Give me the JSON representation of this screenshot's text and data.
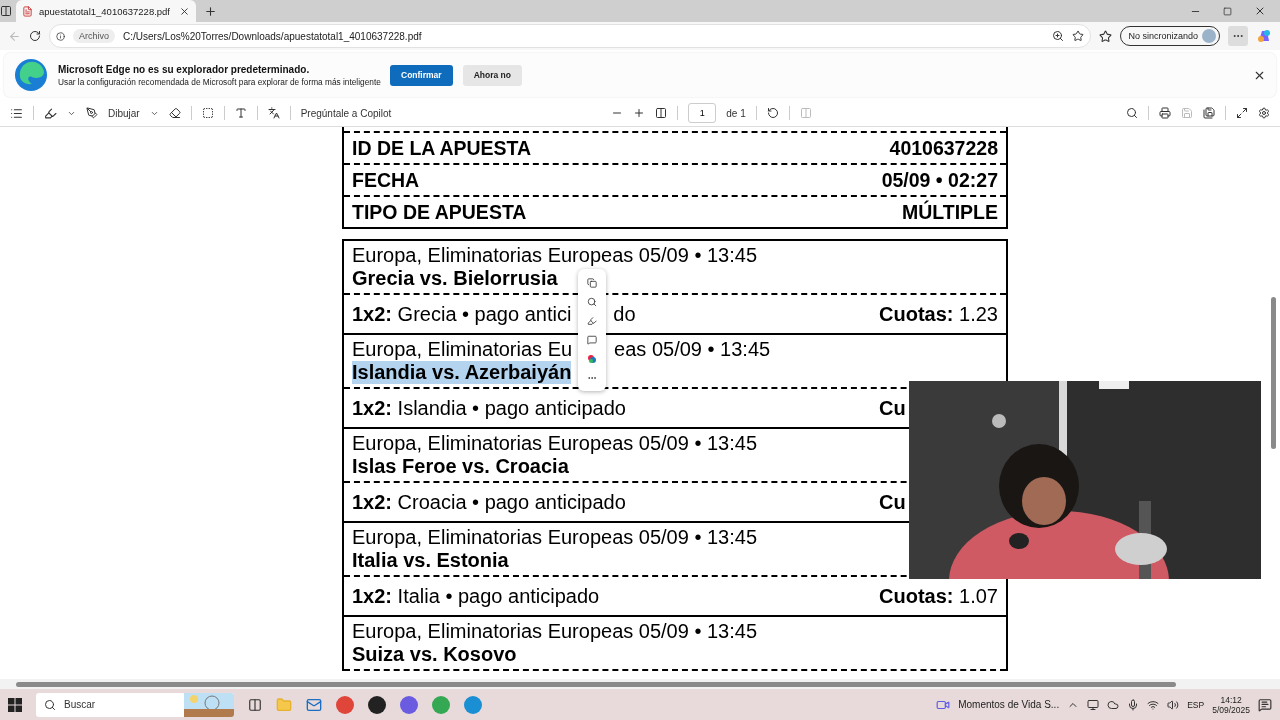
{
  "tab": {
    "title": "apuestatotal1_4010637228.pdf"
  },
  "address_bar": {
    "scheme_label": "Archivo",
    "url": "C:/Users/Los%20Torres/Downloads/apuestatotal1_4010637228.pdf"
  },
  "profile": {
    "label": "No sincronizando"
  },
  "banner": {
    "title": "Microsoft Edge no es su explorador predeterminado.",
    "text": "Usar la configuración recomendada de Microsoft para explorar de forma más inteligente",
    "buttons": [
      {
        "label": "Confirmar",
        "kind": "primary"
      },
      {
        "label": "Ahora no",
        "kind": "secondary"
      }
    ]
  },
  "pdf_toolbar": {
    "draw_label": "Dibujar",
    "copilot_label": "Pregúntale a Copilot",
    "page": "1",
    "page_total": "de 1"
  },
  "summary": [
    {
      "label": "ID DE LA APUESTA",
      "value": "4010637228"
    },
    {
      "label": "FECHA",
      "value": "05/09 • 02:27"
    },
    {
      "label": "TIPO DE APUESTA",
      "value": "MÚLTIPLE"
    }
  ],
  "bets": [
    {
      "header": [
        "Europa, Eliminatorias Europeas 05/09 • 13:45"
      ],
      "match": "Grecia vs. Bielorrusia",
      "match_selected": false,
      "pick_label": "1x2:",
      "pick": [
        "Grecia • pago antici",
        "do"
      ],
      "odds_label": "Cuotas:",
      "odds": "1.23"
    },
    {
      "header": [
        "Europa, Eliminatorias Eu",
        "eas 05/09 • 13:45"
      ],
      "match": "Islandia vs. Azerbaiyán",
      "match_selected": true,
      "pick_label": "1x2:",
      "pick": [
        "Islandia • pago anticipado"
      ],
      "odds_label": "Cu"
    },
    {
      "header": [
        "Europa, Eliminatorias Europeas 05/09 • 13:45"
      ],
      "match": "Islas Feroe vs. Croacia",
      "match_selected": false,
      "pick_label": "1x2:",
      "pick": [
        "Croacia • pago anticipado"
      ],
      "odds_label": "Cu"
    },
    {
      "header": [
        "Europa, Eliminatorias Europeas 05/09 • 13:45"
      ],
      "match": "Italia vs. Estonia",
      "match_selected": false,
      "pick_label": "1x2:",
      "pick": [
        "Italia • pago anticipado"
      ],
      "odds_label": "Cuotas:",
      "odds": "1.07"
    },
    {
      "header": [
        "Europa, Eliminatorias Europeas 05/09 • 13:45"
      ],
      "match": "Suiza vs. Kosovo",
      "match_selected": false
    }
  ],
  "taskbar": {
    "search_placeholder": "Buscar",
    "media": "Momentos de Vida S...",
    "language": "ESP",
    "time": "14:12",
    "date": "5/09/2025"
  }
}
